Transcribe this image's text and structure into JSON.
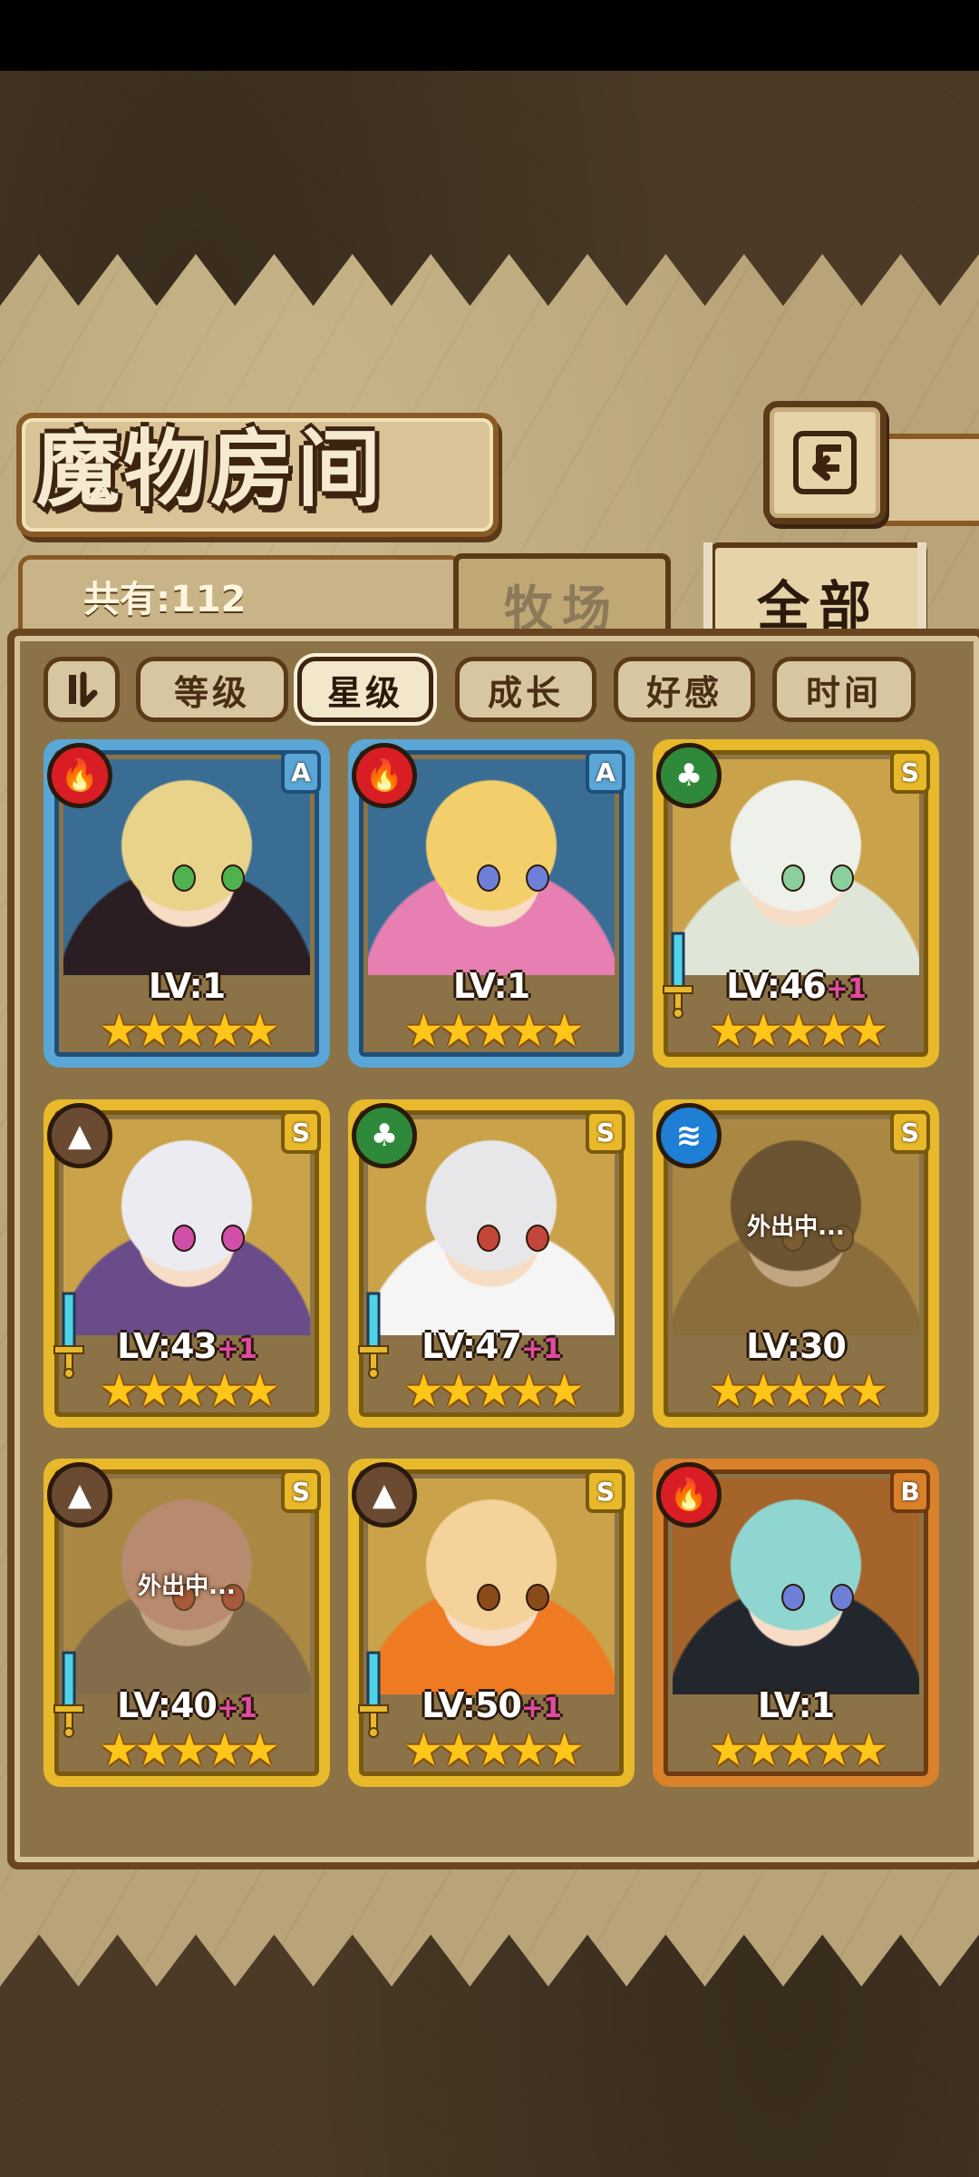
{
  "header": {
    "title": "魔物房间",
    "back_icon": "back-arrow-icon",
    "count_text": "共有:112"
  },
  "tabs": [
    {
      "label": "牧场",
      "selected": false
    },
    {
      "label": "全部",
      "selected": true
    }
  ],
  "sort": {
    "toggle_icon": "sort-order-icon",
    "options": [
      {
        "label": "等级",
        "selected": false
      },
      {
        "label": "星级",
        "selected": true
      },
      {
        "label": "成长",
        "selected": false
      },
      {
        "label": "好感",
        "selected": false
      },
      {
        "label": "时间",
        "selected": false
      }
    ]
  },
  "colors": {
    "frame_blue": "#5aa6d6",
    "frame_gold": "#e8b92a",
    "frame_bronze": "#d9822b",
    "fire": "#d81e24",
    "leaf": "#2e8a3a",
    "earth": "#6b4a32",
    "water": "#1e7fd4",
    "plus_pink": "#e24aa0"
  },
  "cards": [
    {
      "element": "fire",
      "rank": "A",
      "level": "LV:1",
      "plus": "",
      "stars": "★★★★★",
      "away": "",
      "frame": "blue",
      "sword": false
    },
    {
      "element": "fire",
      "rank": "A",
      "level": "LV:1",
      "plus": "",
      "stars": "★★★★★",
      "away": "",
      "frame": "blue",
      "sword": false
    },
    {
      "element": "leaf",
      "rank": "S",
      "level": "LV:46",
      "plus": "+1",
      "stars": "★★★★★",
      "away": "",
      "frame": "gold",
      "sword": true
    },
    {
      "element": "earth",
      "rank": "S",
      "level": "LV:43",
      "plus": "+1",
      "stars": "★★★★★",
      "away": "",
      "frame": "gold",
      "sword": true
    },
    {
      "element": "leaf",
      "rank": "S",
      "level": "LV:47",
      "plus": "+1",
      "stars": "★★★★★",
      "away": "",
      "frame": "gold",
      "sword": true
    },
    {
      "element": "water",
      "rank": "S",
      "level": "LV:30",
      "plus": "",
      "stars": "★★★★★",
      "away": "外出中...",
      "frame": "gold",
      "sword": false
    },
    {
      "element": "earth",
      "rank": "S",
      "level": "LV:40",
      "plus": "+1",
      "stars": "★★★★★",
      "away": "外出中...",
      "frame": "gold",
      "sword": true
    },
    {
      "element": "earth",
      "rank": "S",
      "level": "LV:50",
      "plus": "+1",
      "stars": "★★★★★",
      "away": "",
      "frame": "gold",
      "sword": true
    },
    {
      "element": "fire",
      "rank": "B",
      "level": "LV:1",
      "plus": "",
      "stars": "★★★★★",
      "away": "",
      "frame": "bronze",
      "sword": false
    }
  ]
}
